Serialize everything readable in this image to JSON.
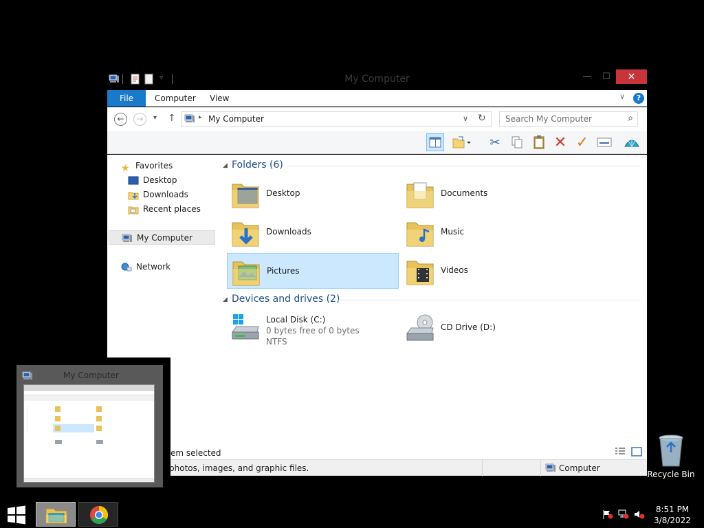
{
  "window": {
    "title": "My Computer",
    "close_glyph": "✕",
    "minimize_glyph": "—",
    "maximize_glyph": "☐"
  },
  "ribbon": {
    "tabs": [
      "File",
      "Computer",
      "View"
    ],
    "collapse_glyph": "∨",
    "help_glyph": "?"
  },
  "nav": {
    "back_glyph": "←",
    "forward_glyph": "→",
    "recent_glyph": "▾",
    "up_glyph": "↑",
    "breadcrumb_sep": "▸",
    "address": "My Computer",
    "dropdown_glyph": "∨",
    "refresh_glyph": "↻",
    "search_placeholder": "Search My Computer",
    "search_glyph": "⌕"
  },
  "navpane": {
    "favorites": "Favorites",
    "items": [
      "Desktop",
      "Downloads",
      "Recent places"
    ],
    "my_computer": "My Computer",
    "network": "Network"
  },
  "groups": {
    "folders_header": "Folders (6)",
    "drives_header": "Devices and drives (2)",
    "collapse_glyph": "◢"
  },
  "folders": [
    {
      "name": "Desktop",
      "icon": "desktop-folder-icon"
    },
    {
      "name": "Documents",
      "icon": "documents-folder-icon"
    },
    {
      "name": "Downloads",
      "icon": "downloads-folder-icon"
    },
    {
      "name": "Music",
      "icon": "music-folder-icon"
    },
    {
      "name": "Pictures",
      "icon": "pictures-folder-icon",
      "selected": true
    },
    {
      "name": "Videos",
      "icon": "videos-folder-icon"
    }
  ],
  "drives": [
    {
      "name": "Local Disk (C:)",
      "free": "0 bytes free of 0 bytes",
      "fs": "NTFS",
      "icon": "local-disk-icon"
    },
    {
      "name": "CD Drive (D:)",
      "icon": "cd-drive-icon"
    }
  ],
  "status": {
    "selection": "em selected",
    "details": "photos, images, and graphic files.",
    "location": "Computer"
  },
  "thumbnail": {
    "title": "My Computer"
  },
  "desktop": {
    "recycle_bin": "Recycle Bin"
  },
  "clock": {
    "time": "8:51 PM",
    "date": "3/8/2022"
  },
  "colors": {
    "accent": "#1979ca",
    "close": "#c7353a",
    "selection": "#cce8ff",
    "group_header": "#1e4e8c"
  }
}
